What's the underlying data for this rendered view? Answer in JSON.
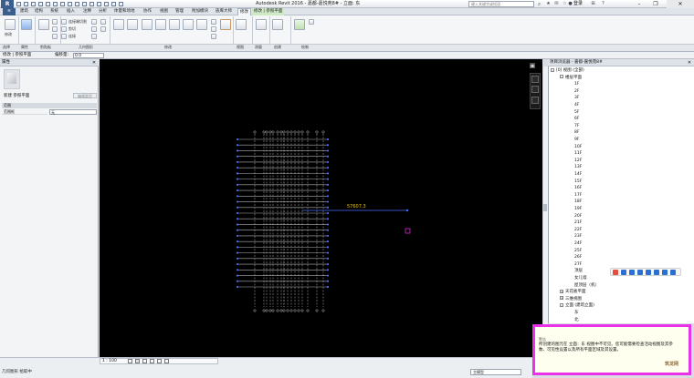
{
  "window": {
    "title": "Autodesk Revit 2016 -   嘉都-嘉悦苑8# - 立面: 东",
    "help_search_placeholder": "键入关键字或短语",
    "login_label": "登录"
  },
  "ribbon": {
    "tabs": [
      "建筑",
      "结构",
      "系统",
      "插入",
      "注释",
      "分析",
      "体量和场地",
      "协作",
      "视图",
      "管理",
      "附加模块",
      "族库大师",
      "修改",
      "修改 | 参照平面"
    ],
    "active_tab": "修改 | 参照平面",
    "panels": [
      "选择",
      "属性",
      "剪贴板",
      "几何图形",
      "修改",
      "视图",
      "测量",
      "创建",
      "绘制"
    ],
    "buttons": {
      "modify": "修改",
      "join_geometry": "连接端切割",
      "cut": "剪切",
      "join": "连接"
    }
  },
  "options_bar": {
    "mode_label": "修改 | 参照平面",
    "offset_label": "偏移量:",
    "offset_value": "0.0"
  },
  "properties": {
    "title": "属性",
    "type_label": "新建 参照平面",
    "edit_type": "编辑类型",
    "section": "范围",
    "row_label": "范围框",
    "row_value": "无",
    "help_link": "属性帮助",
    "apply": "应用"
  },
  "canvas": {
    "dimension_label": "57607.3",
    "background": "#000000",
    "accent": "#4a6cff",
    "highlight": "#e832e8",
    "level_markers": 27
  },
  "browser": {
    "title": "项目浏览器 - 嘉都-嘉悦苑8#",
    "tree": [
      {
        "label": "[0] 视图 (全部)",
        "level": 0,
        "toggle": "-"
      },
      {
        "label": "楼层平面",
        "level": 1,
        "toggle": "-"
      },
      {
        "label": "1F",
        "level": 2
      },
      {
        "label": "2F",
        "level": 2
      },
      {
        "label": "3F",
        "level": 2
      },
      {
        "label": "4F",
        "level": 2
      },
      {
        "label": "5F",
        "level": 2
      },
      {
        "label": "6F",
        "level": 2
      },
      {
        "label": "7F",
        "level": 2
      },
      {
        "label": "8F",
        "level": 2
      },
      {
        "label": "9F",
        "level": 2
      },
      {
        "label": "10F",
        "level": 2
      },
      {
        "label": "11F",
        "level": 2
      },
      {
        "label": "12F",
        "level": 2
      },
      {
        "label": "13F",
        "level": 2
      },
      {
        "label": "14F",
        "level": 2
      },
      {
        "label": "15F",
        "level": 2
      },
      {
        "label": "16F",
        "level": 2
      },
      {
        "label": "17F",
        "level": 2
      },
      {
        "label": "18F",
        "level": 2
      },
      {
        "label": "19F",
        "level": 2
      },
      {
        "label": "20F",
        "level": 2
      },
      {
        "label": "21F",
        "level": 2
      },
      {
        "label": "22F",
        "level": 2
      },
      {
        "label": "23F",
        "level": 2
      },
      {
        "label": "24F",
        "level": 2
      },
      {
        "label": "25F",
        "level": 2
      },
      {
        "label": "26F",
        "level": 2
      },
      {
        "label": "27F",
        "level": 2
      },
      {
        "label": "顶层",
        "level": 2
      },
      {
        "label": "女儿墙",
        "level": 2
      },
      {
        "label": "屋顶层（机）",
        "level": 2
      },
      {
        "label": "天花板平面",
        "level": 1,
        "toggle": "+"
      },
      {
        "label": "三维视图",
        "level": 1,
        "toggle": "+"
      },
      {
        "label": "立面 (建筑立面)",
        "level": 1,
        "toggle": "-"
      },
      {
        "label": "东",
        "level": 2
      },
      {
        "label": "北",
        "level": 2
      }
    ]
  },
  "warning": {
    "title": "警告",
    "text": "所创建的图元在 立面：东 视图中不可见。您可能需要检查活动视图及其参数、可见性设置以及所有平面区域及其设置。",
    "brand": "筑龙网"
  },
  "status": {
    "scale": "1 : 100",
    "text": "单击可进行选择; 按 Tab 键并单击可选择其他项目; 按 Ctrl 键并单击可将新项目添加到选择集; 按 Shift 键并单击可取消选择。",
    "short_text": "几何图形 拾取中",
    "model": "主模型"
  }
}
